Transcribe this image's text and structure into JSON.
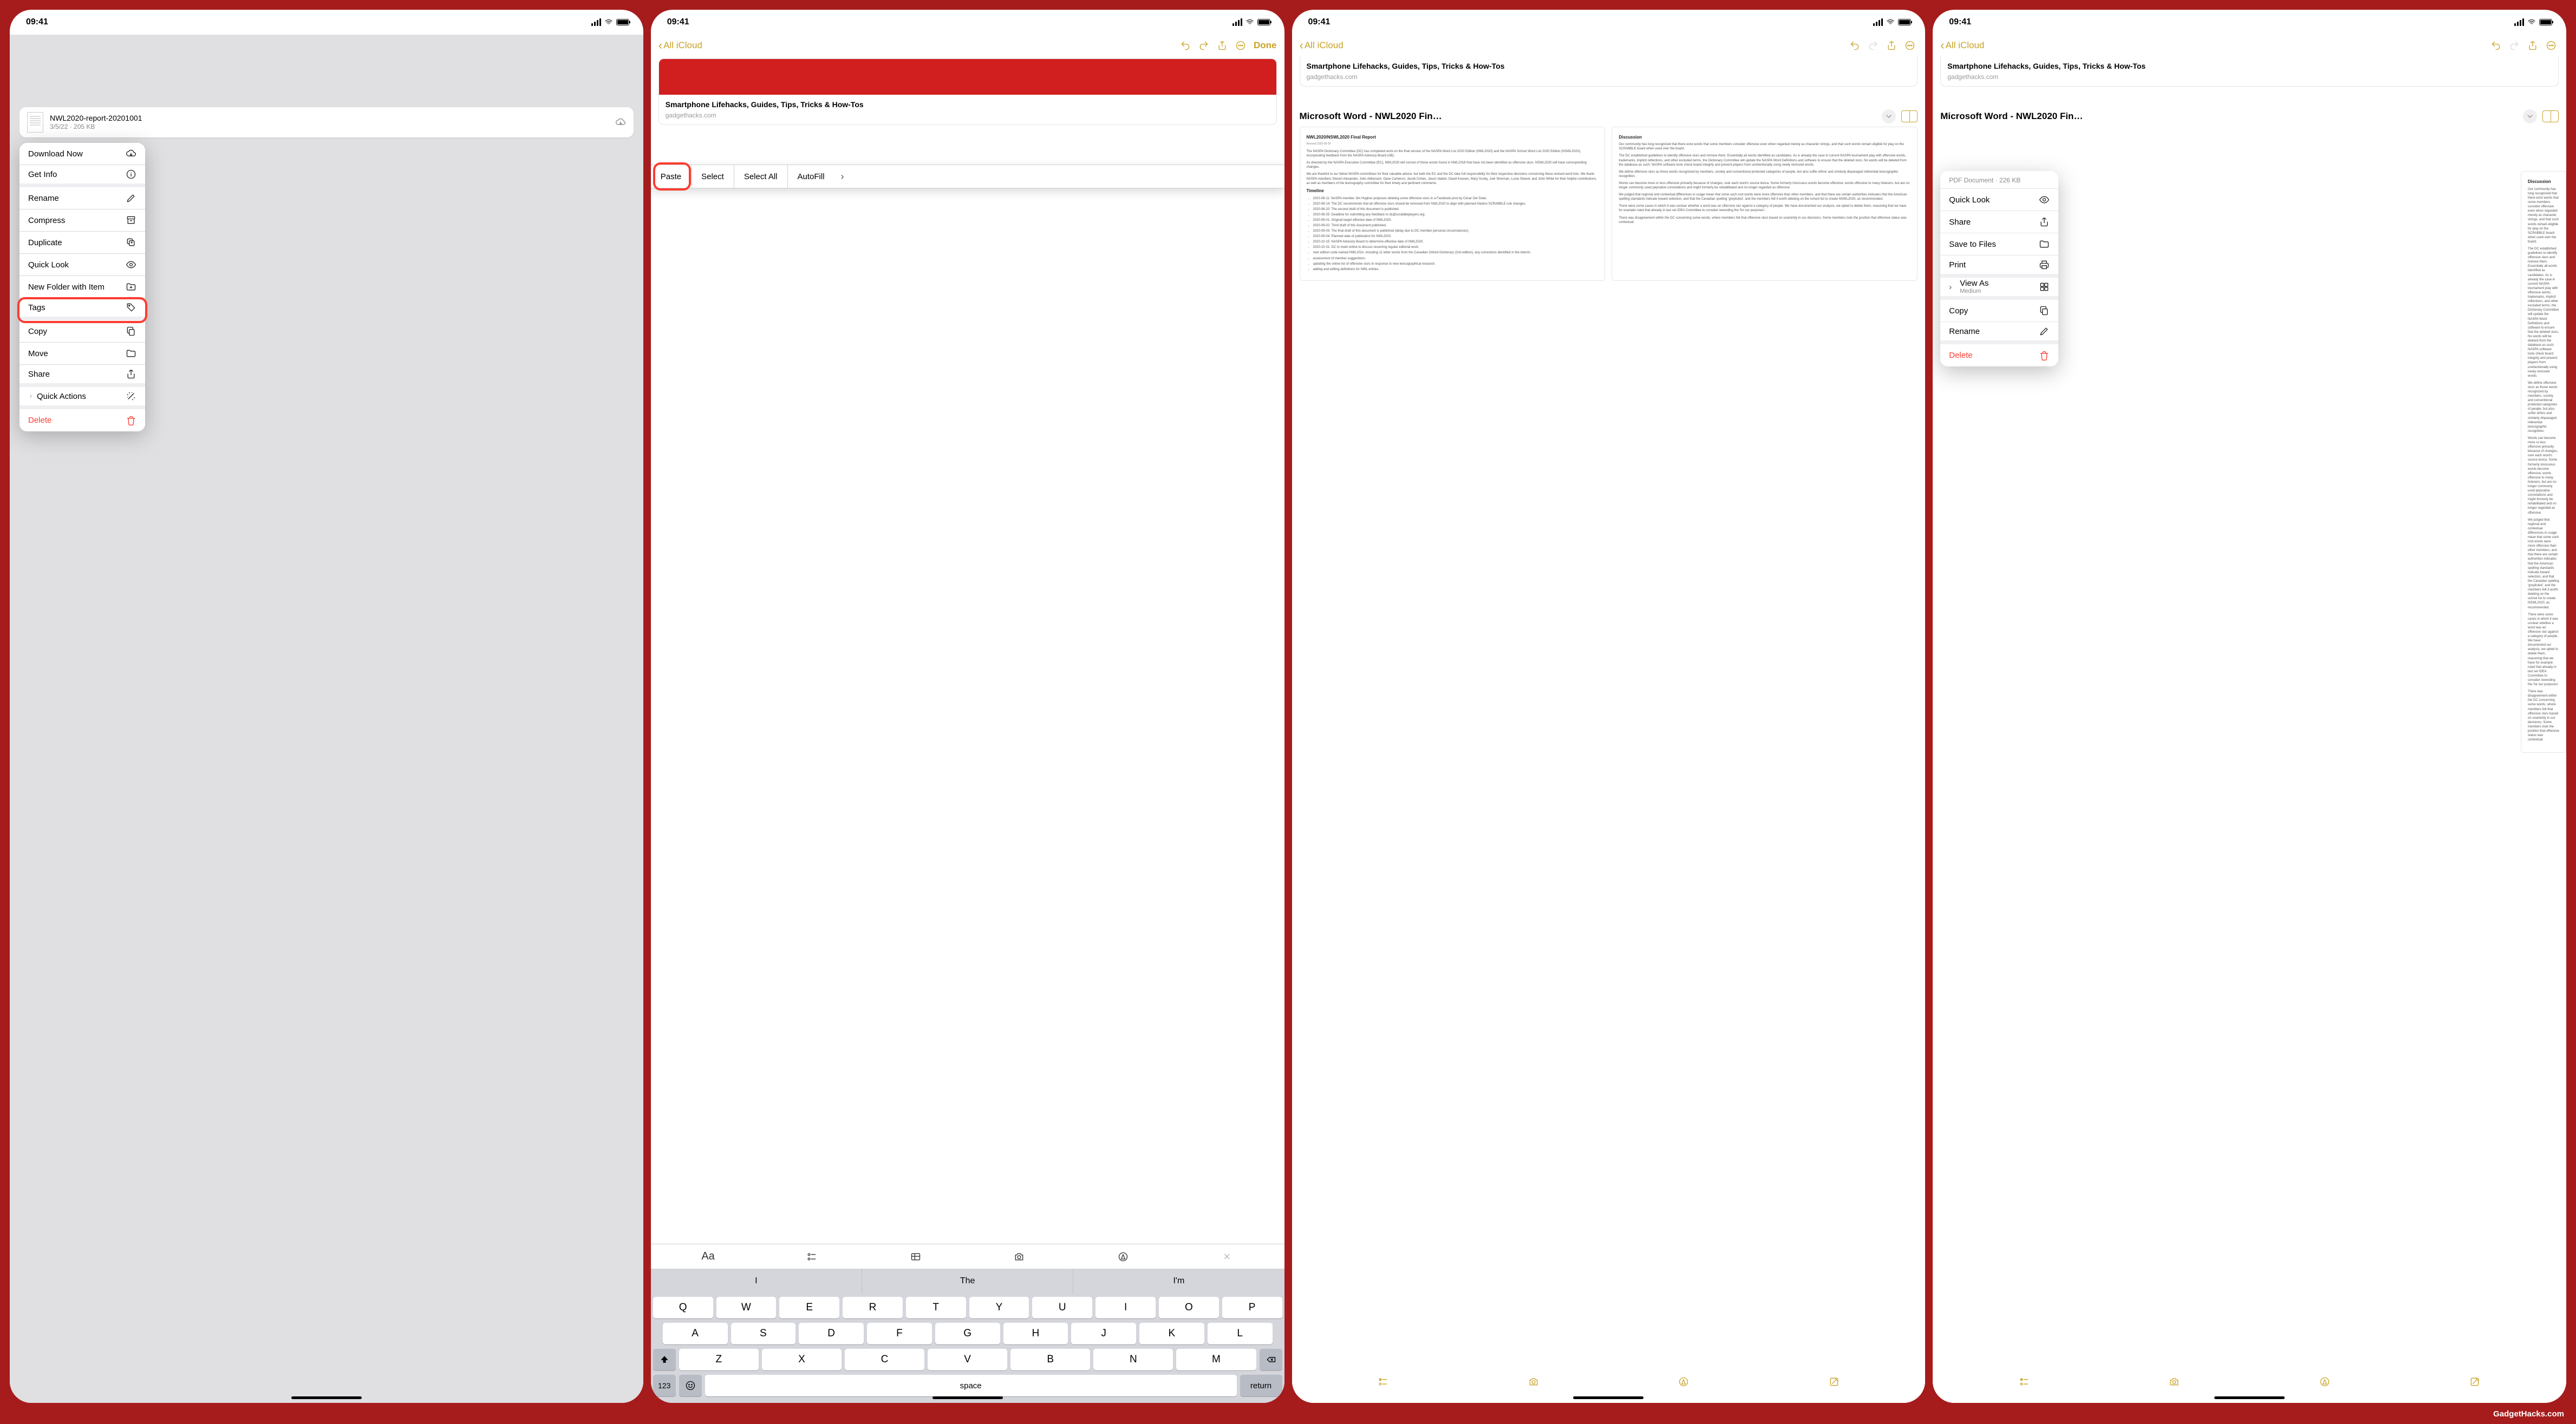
{
  "footer": "GadgetHacks.com",
  "status": {
    "time": "09:41"
  },
  "phone1": {
    "file": {
      "name": "NWL2020-report-20201001",
      "meta": "3/5/22 · 205 KB"
    },
    "menu": {
      "download": "Download Now",
      "getinfo": "Get Info",
      "rename": "Rename",
      "compress": "Compress",
      "duplicate": "Duplicate",
      "quicklook": "Quick Look",
      "newfolder": "New Folder with Item",
      "tags": "Tags",
      "copy": "Copy",
      "move": "Move",
      "share": "Share",
      "quickactions": "Quick Actions",
      "delete": "Delete"
    }
  },
  "notes": {
    "back_label": "All iCloud",
    "done_label": "Done",
    "link": {
      "title": "Smartphone Lifehacks, Guides, Tips, Tricks & How-Tos",
      "domain": "gadgethacks.com"
    },
    "attachment_title": "Microsoft Word - NWL2020 Fin…"
  },
  "phone2": {
    "edit_menu": {
      "paste": "Paste",
      "select": "Select",
      "select_all": "Select All",
      "autofill": "AutoFill"
    },
    "suggest": [
      "I",
      "The",
      "I'm"
    ],
    "keys": {
      "r1": [
        "Q",
        "W",
        "E",
        "R",
        "T",
        "Y",
        "U",
        "I",
        "O",
        "P"
      ],
      "r2": [
        "A",
        "S",
        "D",
        "F",
        "G",
        "H",
        "J",
        "K",
        "L"
      ],
      "r3": [
        "Z",
        "X",
        "C",
        "V",
        "B",
        "N",
        "M"
      ],
      "num": "123",
      "space": "space",
      "return": "return"
    }
  },
  "doc": {
    "title": "NWL2020/NSWL2020 Final Report",
    "revised": "Revised 2020-09-30",
    "p1": "The NASPA Dictionary Committee (DC) has completed work on the final version of the NASPA Word List 2020 Edition (NWL2020) and the NASPA School Word List 2020 Edition (NSWL2020), incorporating feedback from the NASPA Advisory Board (AB).",
    "p2": "As directed by the NASPA Executive Committee (EC), NWL2020 will consist of those words found in NWL2018 that have not been identified as offensive slurs. NSWL2020 will have corresponding changes.",
    "p3": "We are thankful to our fellow NASPA committees for their valuable advice, but both the EC and the DC take full responsibility for their respective decisions concerning these revised word lists. We thank NASPA members Steven Alexander, John Aitkenach, Dave Cameron, Jacob Cohen, Jason Idalski, David Koenen, Mary Scoby, Joel Sherman, Luise Shavel, and John White for their helpful contributions, as well as members of the lexicography committee for their timely and pertinent comments.",
    "timeline_h": "Timeline",
    "timeline": [
      "2020-08-11: NASPA member Jim Hughes proposes deleting some offensive slurs in a Facebook post by César Del Solar.",
      "2020-08-14: The DC recommends that all offensive slurs should be removed from NWL2020 to align with planned Hasbro SCRABBLE rule changes.",
      "2020-08-20: The second draft of this document is published.",
      "2020-08-25: Deadline for submitting any feedback to dc@scrabbleplayers.org.",
      "2020-09-01: Original target effective date of NWL2020.",
      "2020-09-02: Third draft of this document published.",
      "2020-09-03: The final draft of this document is published (delay due to DC member personal circumstances).",
      "2020-09-04: Planned date of publication for NWL2020.",
      "2020-10-15: NASPA Advisory Board to determine effective date of NWL2020.",
      "2020-10-31: DC to meet online to discuss resuming regular editorial work.",
      "next edition code-named NWL202x, including 11 letter words from the Canadian Oxford Dictionary (2nd edition), any corrections identified in the interim.",
      "assessment of member suggestions.",
      "updating the online list of offensive slurs in response to new lexicographical research.",
      "adding and editing definitions for NWL entries."
    ],
    "disc_h": "Discussion",
    "d1": "Our community has long recognized that there exist words that some members consider offensive even when regarded merely as character strings, and that such words remain eligible for play on the SCRABBLE board when used over the board.",
    "d2": "The DC established guidelines to identify offensive slurs and remove them. Essentially all words identified as candidates. As is already the case in current NASPA tournament play with offensive words, trademarks, implicit reflections, and other excluded terms, the Dictionary Committee will update the NASPA Word Definitions and software to ensure that the deleted slurs. No words will be deleted from the database as such; NASPA software tools check board integrity and prevent players from unintentionally using newly removed words.",
    "d3": "We define offensive slurs as those words recognized by members, society and conventional protected categories of people, but also suffer ethnic and similarly disparaged referential lexicographic recognition.",
    "d4": "Words can become more or less offensive primarily because of changes, over each word's source lexica. Some formerly innocuous words become offensive; words offensive to many listeners, but are no longer commonly used pejorative connotations and might formerly be rehabilitated and no longer regarded as offensive.",
    "d5": "We judged that regional and contextual differences in usage mean that some such root words were more offensive than other members, and that there are certain authorities indicates that the American spelling standards indicate toward selection, and that the Canadian spelling 'greylisted', and the members felt it worth deleting on the school list to create NSWL2020, as recommended.",
    "d6": "There were some cases in which it was unclear whether a word was an offensive slur against a category of people. We have documented our analysis, we opted to delete them, reasoning that we have for example ruled that already in last set IDEA Committee to consider rewording the 'for our purposes'.",
    "d7": "There was disagreement within the DC concerning some words, where members felt that offensive slurs based on unanimity in our decisions. Some members took the position that offensive status was contextual."
  },
  "phone4": {
    "meta": "PDF Document · 226 KB",
    "menu": {
      "quicklook": "Quick Look",
      "share": "Share",
      "savefiles": "Save to Files",
      "print": "Print",
      "viewas": "View As",
      "viewas_sub": "Medium",
      "copy": "Copy",
      "rename": "Rename",
      "delete": "Delete"
    }
  }
}
